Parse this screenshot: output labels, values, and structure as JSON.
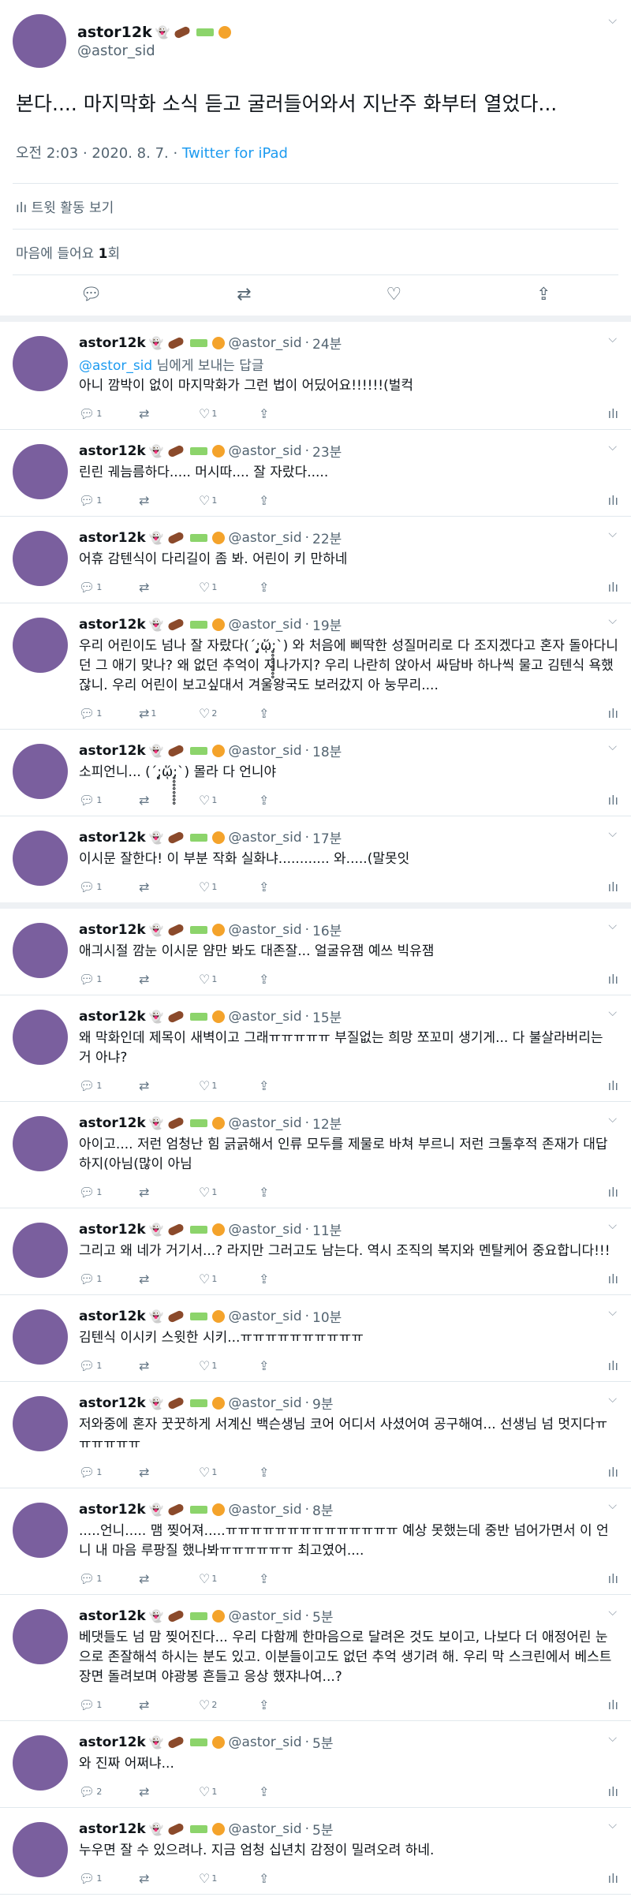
{
  "main": {
    "name": "astor12k",
    "handle": "@astor_sid",
    "text": "본다.... 마지막화 소식 듣고 굴러들어와서 지난주 화부터 열었다...",
    "time": "오전 2:03 · 2020. 8. 7. · ",
    "via": "Twitter for iPad",
    "activity_label": "트윗 활동 보기",
    "likes_prefix": "마음에 들어요 ",
    "likes_count": "1",
    "likes_suffix": "회"
  },
  "reply_to": {
    "mention": "@astor_sid",
    "suffix": " 님에게 보내는 답글"
  },
  "replies": [
    {
      "name": "astor12k",
      "handle": "@astor_sid",
      "time": "24분",
      "text": "아니 깜박이 없이 마지막화가 그런 법이 어딨어요!!!!!!(벌컥",
      "reply": "1",
      "retweet": "",
      "like": "1"
    },
    {
      "name": "astor12k",
      "handle": "@astor_sid",
      "time": "23분",
      "text": "린린 궤늠름하다..... 머시따.... 잘 자랐다.....",
      "reply": "1",
      "retweet": "",
      "like": "1"
    },
    {
      "name": "astor12k",
      "handle": "@astor_sid",
      "time": "22분",
      "text": "어휴 감텐식이 다리길이 좀 봐. 어린이 키 만하네",
      "reply": "1",
      "retweet": "",
      "like": "1"
    },
    {
      "name": "astor12k",
      "handle": "@astor_sid",
      "time": "19분",
      "text": "우리 어린이도 넘나 잘 자랐다(´;̥̥̥̥̥̥̥̥ᾥ;̥̥̥̥̥̥̥̥`) 와 처음에 삐딱한 성질머리로 다 조지겠다고 혼자 돌아다니던 그 애기 맞나? 왜 없던 추억이 지나가지? 우리 나란히 앉아서 싸담바 하나씩 물고 김텐식 욕했잖니. 우리 어린이 보고싶대서 겨울왕국도 보러갔지 아 눙무리....",
      "reply": "1",
      "retweet": "1",
      "like": "2"
    },
    {
      "name": "astor12k",
      "handle": "@astor_sid",
      "time": "18분",
      "text": "소피언니... (´;̥̥̥̥̥̥̥̥ᾥ;̥̥̥̥̥̥̥̥`) 몰라 다 언니야",
      "reply": "1",
      "retweet": "",
      "like": "1"
    },
    {
      "name": "astor12k",
      "handle": "@astor_sid",
      "time": "17분",
      "text": "이시문 잘한다! 이 부분 작화 실화냐............ 와.....(말못잇",
      "reply": "1",
      "retweet": "",
      "like": "1"
    },
    {
      "name": "astor12k",
      "handle": "@astor_sid",
      "time": "16분",
      "text": "애긔시절 깜눈 이시문 얌만 봐도 대존잘... 얼굴유잼 예쓰 빅유잼",
      "reply": "1",
      "retweet": "",
      "like": "1"
    },
    {
      "name": "astor12k",
      "handle": "@astor_sid",
      "time": "15분",
      "text": "왜 막화인데 제목이 새벽이고 그래ㅠㅠㅠㅠㅠ 부질없는 희망 쪼꼬미 생기게... 다 불살라버리는 거 아냐?",
      "reply": "1",
      "retweet": "",
      "like": "1"
    },
    {
      "name": "astor12k",
      "handle": "@astor_sid",
      "time": "12분",
      "text": "아이고.... 저런 엄청난 힘 긁긁해서 인류 모두를 제물로 바쳐 부르니 저런 크툴후적 존재가 대답하지(아님(많이 아님",
      "reply": "1",
      "retweet": "",
      "like": "1"
    },
    {
      "name": "astor12k",
      "handle": "@astor_sid",
      "time": "11분",
      "text": "그리고 왜 네가 거기서...? 라지만 그러고도 남는다. 역시 조직의 복지와 멘탈케어 중요합니다!!!",
      "reply": "1",
      "retweet": "",
      "like": "1"
    },
    {
      "name": "astor12k",
      "handle": "@astor_sid",
      "time": "10분",
      "text": "김텐식 이시키 스윗한 시키...ㅠㅠㅠㅠㅠㅠㅠㅠㅠㅠ",
      "reply": "1",
      "retweet": "",
      "like": "1"
    },
    {
      "name": "astor12k",
      "handle": "@astor_sid",
      "time": "9분",
      "text": "저와중에 혼자 꿋꿋하게 서계신 백슨생님 코어 어디서 사셨어여 공구해여... 선생님 넘 멋지다ㅠㅠㅠㅠㅠㅠ",
      "reply": "1",
      "retweet": "",
      "like": "1"
    },
    {
      "name": "astor12k",
      "handle": "@astor_sid",
      "time": "8분",
      "text": ".....언니..... 맴 찢어져.....ㅠㅠㅠㅠㅠㅠㅠㅠㅠㅠㅠㅠㅠㅠ 예상 못했는데 중반 넘어가면서 이 언니 내 마음 루팡질 했나봐ㅠㅠㅠㅠㅠㅠ 최고였어....",
      "reply": "1",
      "retweet": "",
      "like": "1"
    },
    {
      "name": "astor12k",
      "handle": "@astor_sid",
      "time": "5분",
      "text": "베댓들도 넘 맘 찢어진다... 우리 다함께 한마음으로 달려온 것도 보이고, 나보다 더 애정어린 눈으로 존잘해석 하시는 분도 있고. 이분들이고도 없던 추억 생기려 해. 우리 막 스크린에서 베스트 장면 돌려보며 야광봉 흔들고 응상 했쟈나여...?",
      "reply": "1",
      "retweet": "",
      "like": "2"
    },
    {
      "name": "astor12k",
      "handle": "@astor_sid",
      "time": "5분",
      "text": "와 진짜 어쩌냐...",
      "reply": "2",
      "retweet": "",
      "like": "1"
    },
    {
      "name": "astor12k",
      "handle": "@astor_sid",
      "time": "5분",
      "text": "누우면 잘 수 있으려나. 지금 엄청 십년치 감정이 밀려오려 하네.",
      "reply": "1",
      "retweet": "",
      "like": "1"
    }
  ],
  "icons": {
    "reply": "reply-icon",
    "retweet": "retweet-icon",
    "like": "heart-icon",
    "share": "share-icon",
    "analytics": "analytics-icon"
  }
}
